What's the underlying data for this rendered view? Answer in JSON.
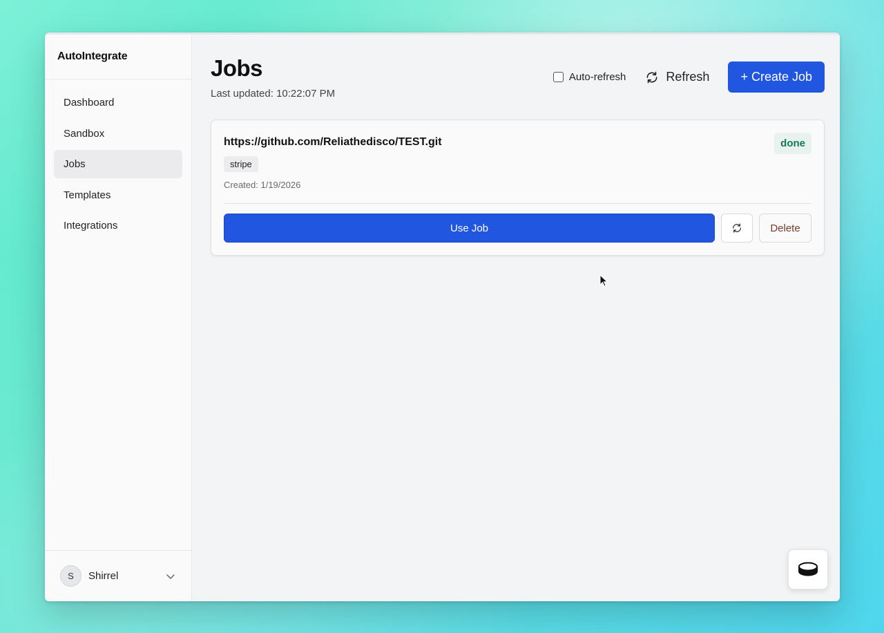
{
  "app": {
    "brand": "AutoIntegrate"
  },
  "sidebar": {
    "items": [
      {
        "label": "Dashboard",
        "active": false
      },
      {
        "label": "Sandbox",
        "active": false
      },
      {
        "label": "Jobs",
        "active": true
      },
      {
        "label": "Templates",
        "active": false
      },
      {
        "label": "Integrations",
        "active": false
      }
    ],
    "user": {
      "initial": "S",
      "name": "Shirrel"
    }
  },
  "header": {
    "title": "Jobs",
    "last_updated": "Last updated: 10:22:07 PM",
    "auto_refresh_label": "Auto-refresh",
    "auto_refresh_checked": false,
    "refresh_label": "Refresh",
    "create_label": "+ Create Job"
  },
  "jobs": [
    {
      "url": "https://github.com/Reliathedisco/TEST.git",
      "status": "done",
      "tag": "stripe",
      "created": "Created: 1/19/2026",
      "use_label": "Use Job",
      "delete_label": "Delete"
    }
  ],
  "colors": {
    "primary": "#2157e0",
    "status_done_text": "#137a4f",
    "status_done_bg": "#e8f2ee"
  },
  "icons": {
    "refresh": "refresh-icon",
    "chevron": "chevron-down-icon",
    "widget": "hockey-puck-icon"
  }
}
